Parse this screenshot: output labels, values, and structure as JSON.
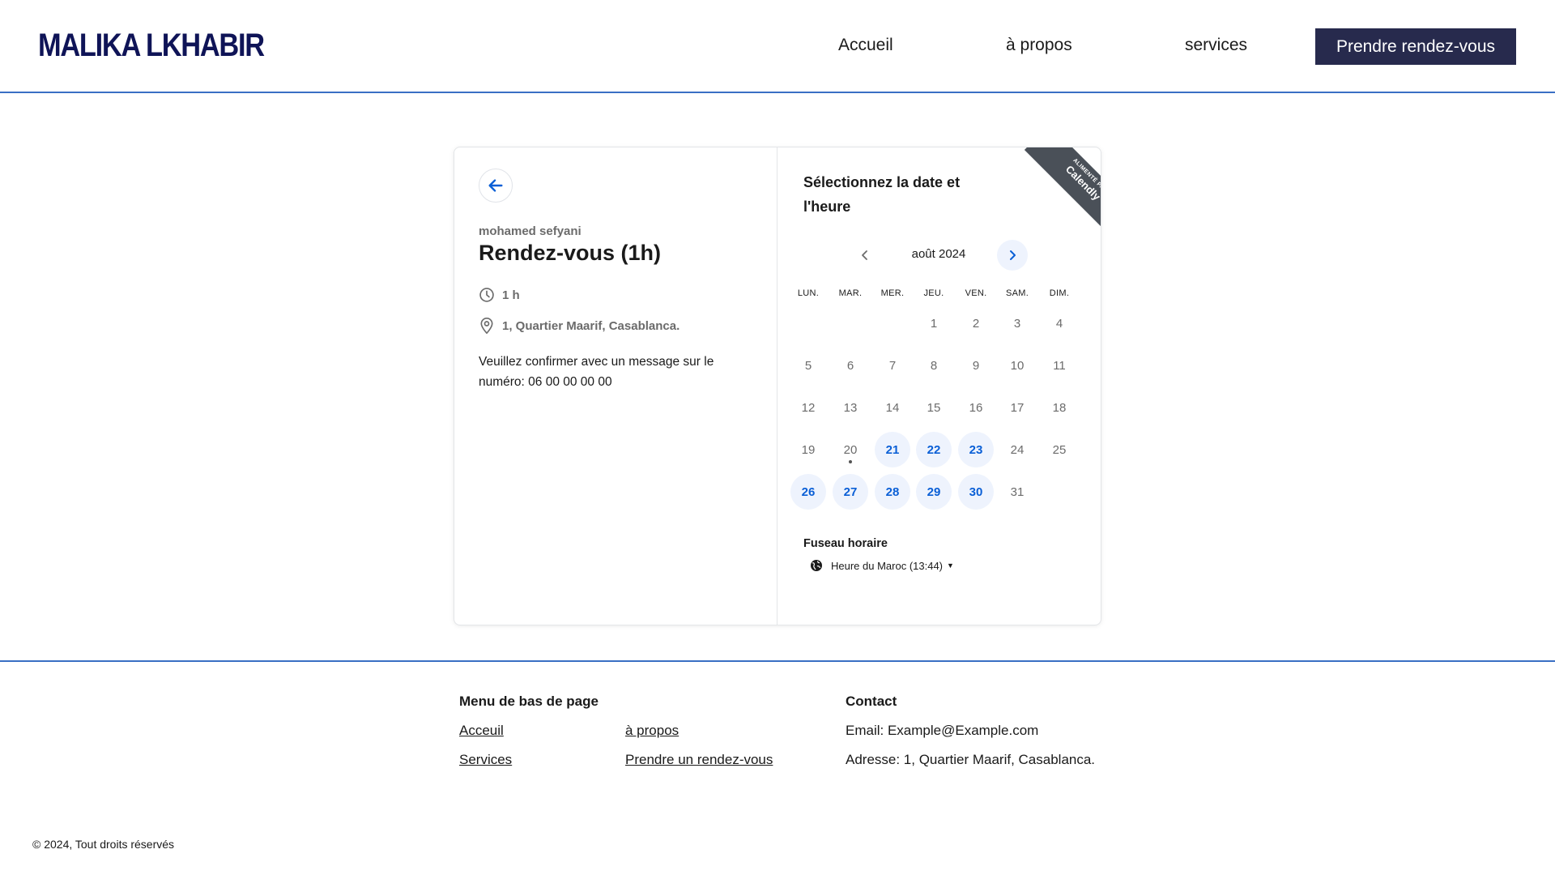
{
  "header": {
    "brand": "MALIKA LKHABIR",
    "nav": [
      "Accueil",
      "à propos",
      "services"
    ],
    "cta": "Prendre rendez-vous"
  },
  "event": {
    "organizer": "mohamed sefyani",
    "title": "Rendez-vous (1h)",
    "duration": "1 h",
    "location": "1, Quartier Maarif, Casablanca.",
    "description": "Veuillez confirmer avec un message sur le numéro: 06 00 00 00 00",
    "icons": [
      "back-arrow-icon",
      "clock-icon",
      "location-pin-icon"
    ]
  },
  "calendar": {
    "title": "Sélectionnez la date et l'heure",
    "ribbon_small": "ALIMENTÉ PAR",
    "ribbon_brand": "Calendly",
    "month": "août 2024",
    "weekdays": [
      "LUN.",
      "MAR.",
      "MER.",
      "JEU.",
      "VEN.",
      "SAM.",
      "DIM."
    ],
    "first_weekday_index": 3,
    "days_in_month": 31,
    "today": 20,
    "available_days": [
      21,
      22,
      23,
      26,
      27,
      28,
      29,
      30
    ],
    "accent_color": "#0a5fd6",
    "available_bg": "#eef3fd"
  },
  "timezone": {
    "title": "Fuseau horaire",
    "value": "Heure du Maroc (13:44)",
    "icon": "globe-icon"
  },
  "footer": {
    "menu_title": "Menu de bas de page",
    "links": [
      "Acceuil",
      "à propos",
      "Services",
      "Prendre un rendez-vous"
    ],
    "contact_title": "Contact",
    "email": "Email: Example@Example.com",
    "address": "Adresse: 1, Quartier Maarif, Casablanca.",
    "copyright": "© 2024, Tout droits réservés"
  },
  "colors": {
    "brand": "#0f1457",
    "cta_bg": "#272a4d",
    "rule": "#3a6fc4"
  }
}
